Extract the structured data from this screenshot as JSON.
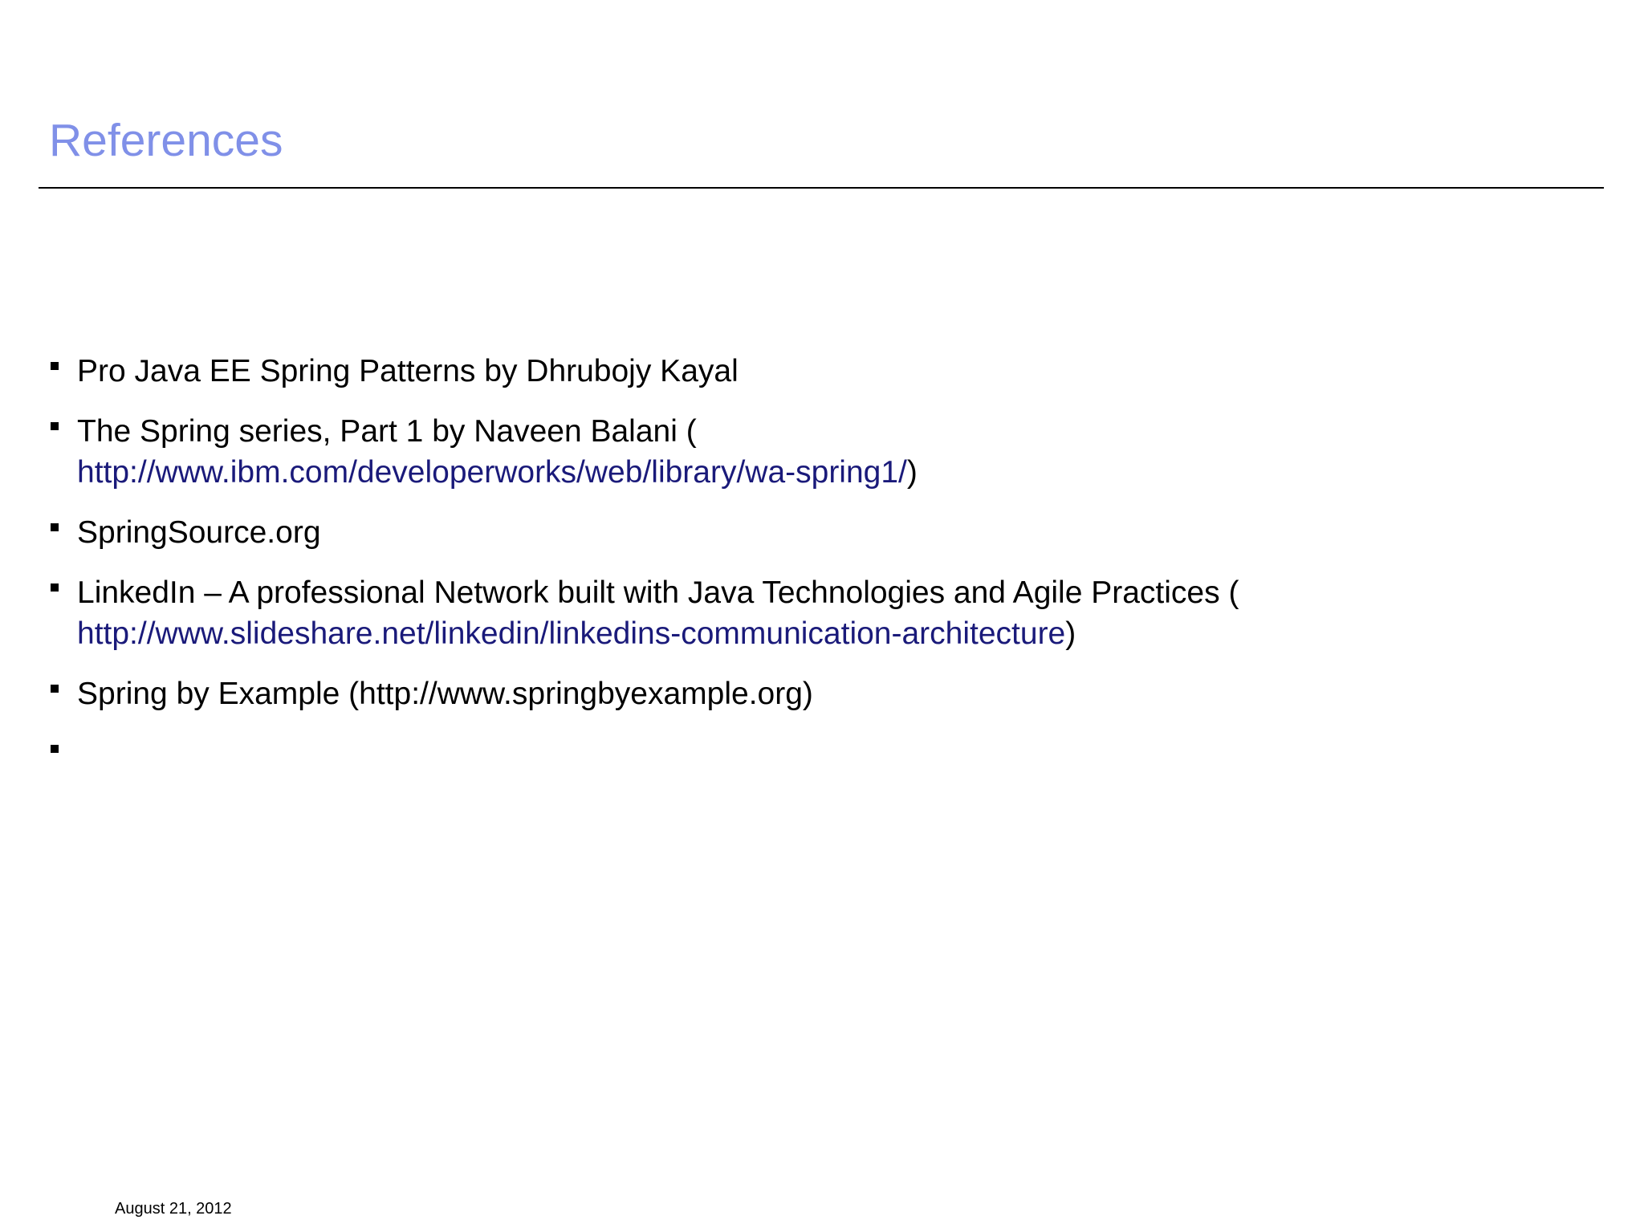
{
  "slide": {
    "title": "References",
    "footer_date": "August 21, 2012"
  },
  "colors": {
    "title": "#8090e8",
    "link": "#1a1a7a",
    "text": "#000000"
  },
  "references": [
    {
      "text": "Pro Java EE Spring Patterns by Dhrubojy Kayal"
    },
    {
      "text": "The Spring series, Part 1 by Naveen Balani (",
      "link": "http://www.ibm.com/developerworks/web/library/wa-spring1/",
      "suffix": ")"
    },
    {
      "text": "SpringSource.org"
    },
    {
      "text": "LinkedIn – A professional Network built with Java Technologies and Agile Practices (",
      "link": "http://www.slideshare.net/linkedin/linkedins-communication-architecture",
      "suffix": ")"
    },
    {
      "text": "Spring by Example (http://www.springbyexample.org)"
    },
    {
      "text": ""
    }
  ]
}
